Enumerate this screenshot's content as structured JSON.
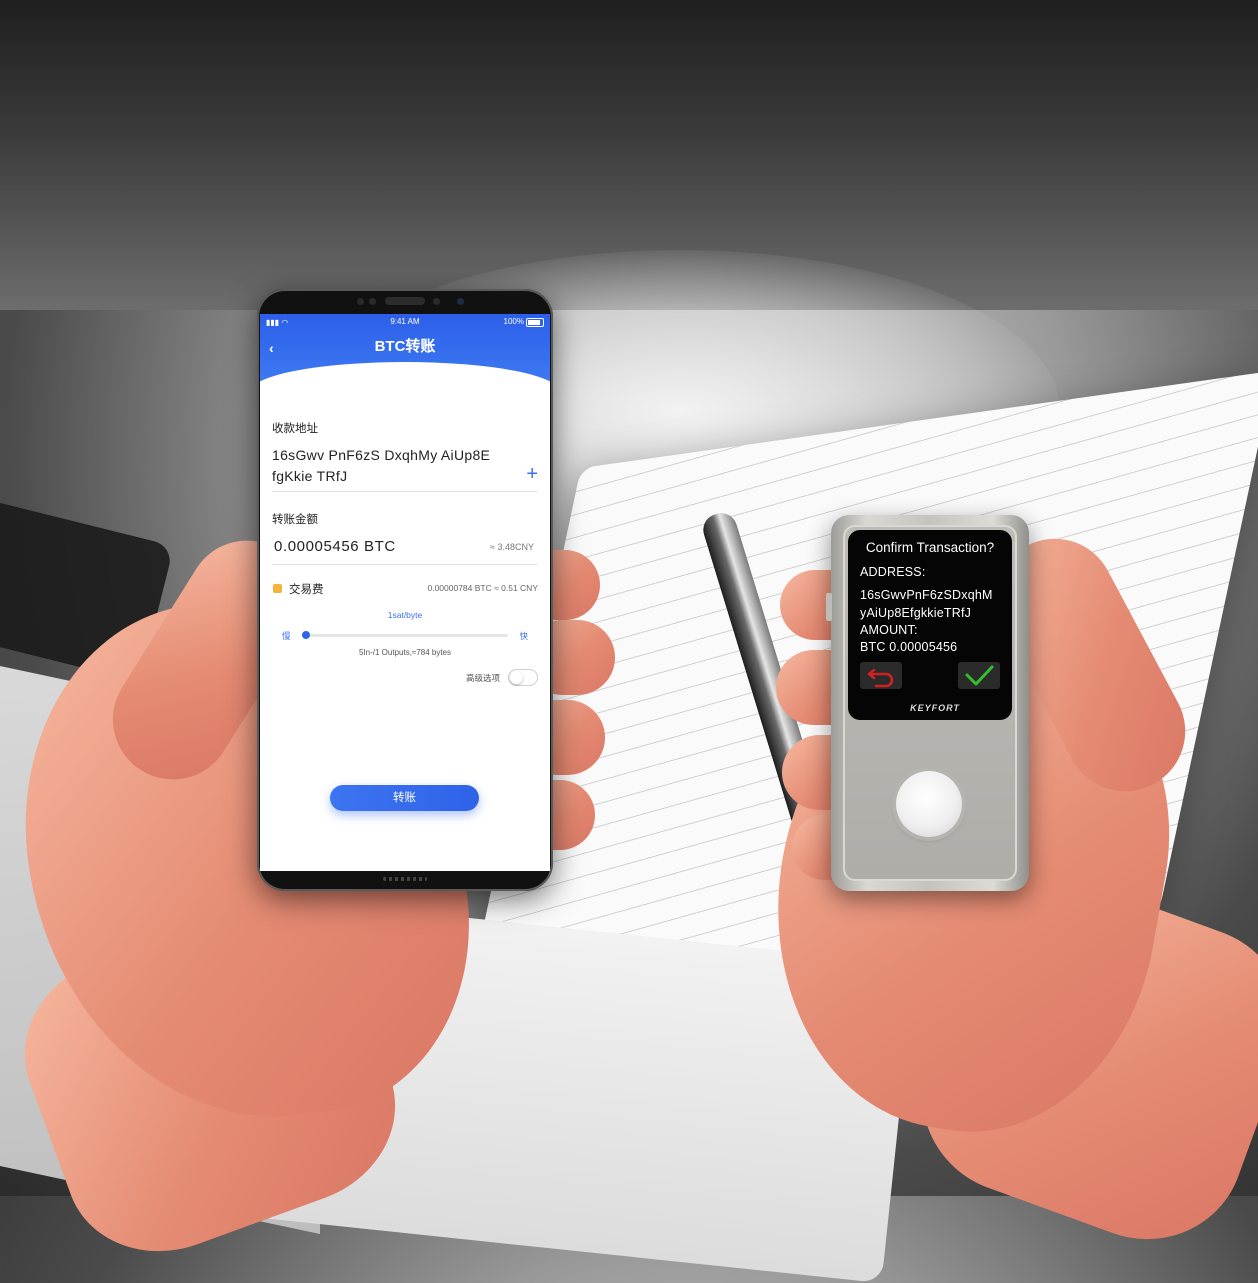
{
  "phone": {
    "status_bar": {
      "time": "9:41 AM",
      "battery": "100%"
    },
    "header": {
      "back_glyph": "‹",
      "title": "BTC转账"
    },
    "recipient": {
      "label": "收款地址",
      "address_line1": "16sGwv PnF6zS DxqhMy AiUp8E",
      "address_line2": "fgKkie TRfJ",
      "add_glyph": "+"
    },
    "amount": {
      "label": "转账金额",
      "value": "0.00005456 BTC",
      "fiat": "≈ 3.48CNY"
    },
    "fee": {
      "label": "交易费",
      "value": "0.00000784 BTC ≈ 0.51 CNY",
      "rate": "1sat/byte",
      "slow_label": "慢",
      "fast_label": "快",
      "level": 0.0,
      "tx_info": "5In-/1 Outputs,≈784 bytes"
    },
    "advanced": {
      "label": "高级选项",
      "enabled": false
    },
    "send_button": "转账"
  },
  "device": {
    "title": "Confirm Transaction?",
    "address_label": "ADDRESS:",
    "address_line1": "16sGwvPnF6zSDxqhM",
    "address_line2": "yAiUp8EfgkkieTRfJ",
    "amount_label": "AMOUNT:",
    "amount_value": "BTC  0.00005456",
    "brand": "KEYFORT",
    "back_icon": "undo-arrow-icon",
    "ok_icon": "checkmark-icon"
  },
  "colors": {
    "accent_blue": "#2f66ec",
    "fee_icon": "#f4b43b",
    "device_back": "#d02020",
    "device_ok": "#34c02a"
  }
}
